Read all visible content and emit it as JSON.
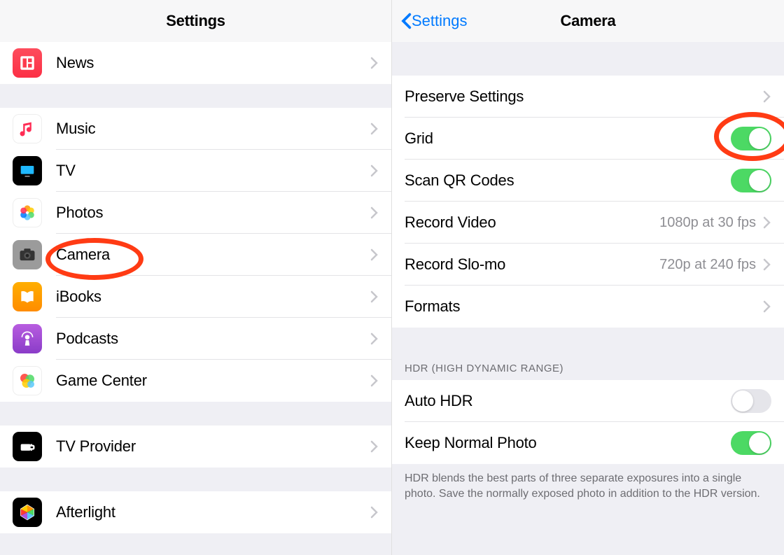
{
  "left": {
    "title": "Settings",
    "group1": [
      {
        "label": "News",
        "icon": "news-icon"
      }
    ],
    "group2": [
      {
        "label": "Music",
        "icon": "music-icon"
      },
      {
        "label": "TV",
        "icon": "tv-icon"
      },
      {
        "label": "Photos",
        "icon": "photos-icon"
      },
      {
        "label": "Camera",
        "icon": "camera-icon"
      },
      {
        "label": "iBooks",
        "icon": "ibooks-icon"
      },
      {
        "label": "Podcasts",
        "icon": "podcasts-icon"
      },
      {
        "label": "Game Center",
        "icon": "gamecenter-icon"
      }
    ],
    "group3": [
      {
        "label": "TV Provider",
        "icon": "tvprovider-icon"
      }
    ],
    "group4": [
      {
        "label": "Afterlight",
        "icon": "afterlight-icon"
      }
    ]
  },
  "right": {
    "back_label": "Settings",
    "title": "Camera",
    "group1": {
      "preserve": "Preserve Settings",
      "grid": "Grid",
      "grid_on": true,
      "scan": "Scan QR Codes",
      "scan_on": true,
      "recvideo": "Record Video",
      "recvideo_val": "1080p at 30 fps",
      "recslomo": "Record Slo-mo",
      "recslomo_val": "720p at 240 fps",
      "formats": "Formats"
    },
    "hdr_header": "HDR (HIGH DYNAMIC RANGE)",
    "hdr": {
      "auto": "Auto HDR",
      "auto_on": false,
      "keep": "Keep Normal Photo",
      "keep_on": true
    },
    "footer": "HDR blends the best parts of three separate exposures into a single photo. Save the normally exposed photo in addition to the HDR version."
  },
  "colors": {
    "accent": "#007aff",
    "toggle_on": "#4cd964",
    "annot": "#ff3b14"
  }
}
